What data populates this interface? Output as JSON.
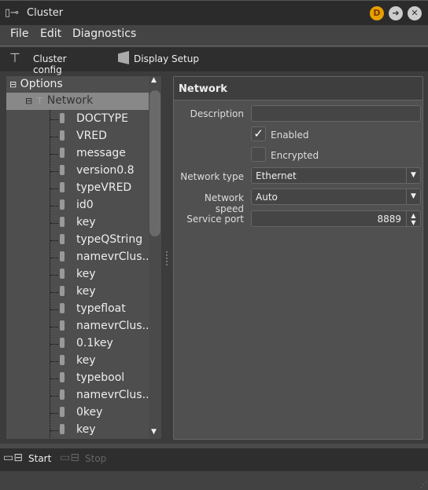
{
  "window": {
    "title": "Cluster",
    "buttons": [
      {
        "name": "d-button",
        "glyph": "D",
        "color": "#e8a000"
      },
      {
        "name": "forward-button",
        "glyph": "➜",
        "color": "#ccc"
      },
      {
        "name": "close-button",
        "glyph": "✕",
        "color": "#ccc"
      }
    ]
  },
  "menu": {
    "items": [
      "File",
      "Edit",
      "Diagnostics"
    ]
  },
  "toolbar": {
    "cluster_config": "Cluster config",
    "display_setup": "Display Setup"
  },
  "tree": {
    "root": "Options",
    "network": "Network",
    "items": [
      "DOCTYPE",
      "VRED",
      "message",
      "version0.8",
      "typeVRED",
      "id0",
      "key",
      "typeQString",
      "namevrClus...",
      "key",
      "key",
      "typefloat",
      "namevrClus...",
      "0.1key",
      "key",
      "typebool",
      "namevrClus...",
      "0key",
      "key"
    ]
  },
  "panel": {
    "title": "Network",
    "description_label": "Description",
    "description_value": "",
    "enabled_label": "Enabled",
    "enabled": true,
    "encrypted_label": "Encrypted",
    "encrypted": false,
    "network_type_label": "Network type",
    "network_type": "Ethernet",
    "network_speed_label": "Network speed",
    "network_speed": "Auto",
    "service_port_label": "Service port",
    "service_port": "8889"
  },
  "bottom": {
    "start": "Start",
    "stop": "Stop"
  }
}
